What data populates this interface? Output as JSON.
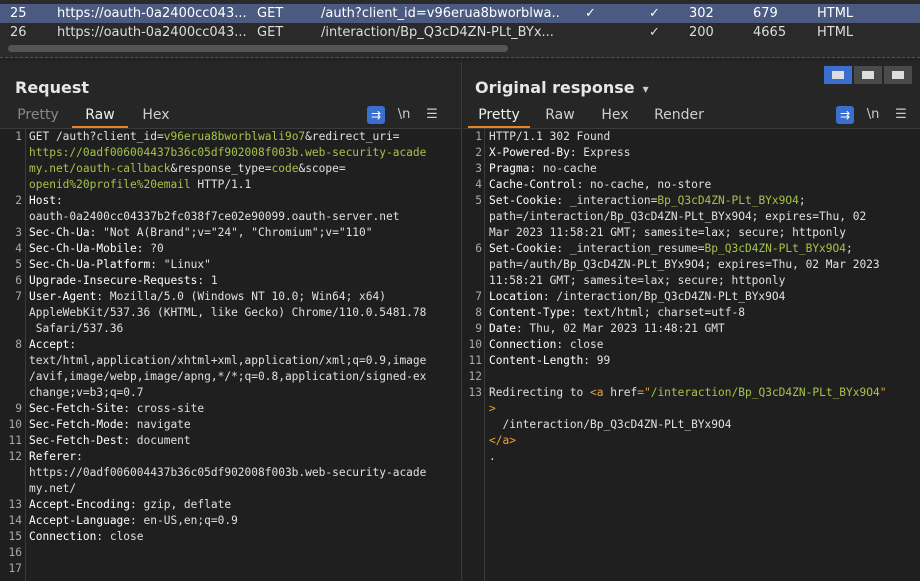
{
  "history": {
    "rows": [
      {
        "num": "25",
        "url": "https://oauth-0a2400cc043...",
        "method": "GET",
        "path": "/auth?client_id=v96erua8bworblwa...",
        "edited": "✓",
        "params": "✓",
        "status": "302",
        "length": "679",
        "mime": "HTML"
      },
      {
        "num": "26",
        "url": "https://oauth-0a2400cc043...",
        "method": "GET",
        "path": "/interaction/Bp_Q3cD4ZN-PLt_BYx...",
        "edited": "",
        "params": "✓",
        "status": "200",
        "length": "4665",
        "mime": "HTML"
      }
    ]
  },
  "request": {
    "title": "Request",
    "tabs": [
      "Pretty",
      "Raw",
      "Hex"
    ],
    "active_tab": "Raw",
    "tools": {
      "wrap": "⇉",
      "newline": "\\n",
      "menu": "☰"
    },
    "line_numbers": [
      "1",
      "",
      "",
      "",
      "2",
      "",
      "3",
      "4",
      "5",
      "6",
      "7",
      "",
      "",
      "8",
      "",
      "",
      "",
      "9",
      "10",
      "11",
      "12",
      "",
      "",
      "13",
      "14",
      "15",
      "16",
      "17"
    ],
    "lines": [
      [
        {
          "t": "GET /auth?client_id=",
          "c": "v"
        },
        {
          "t": "v96erua8bworblwali9o7",
          "c": "g"
        },
        {
          "t": "&redirect_uri=",
          "c": "v"
        }
      ],
      [
        {
          "t": "https://0adf006004437b36c05df902008f003b.web-security-acade",
          "c": "g"
        }
      ],
      [
        {
          "t": "my.net/oauth-callback",
          "c": "g"
        },
        {
          "t": "&response_type=",
          "c": "v"
        },
        {
          "t": "code",
          "c": "g"
        },
        {
          "t": "&scope=",
          "c": "v"
        }
      ],
      [
        {
          "t": "openid%20profile%20email",
          "c": "g"
        },
        {
          "t": " HTTP/1.1",
          "c": "v"
        }
      ],
      [
        {
          "t": "Host",
          "c": "k"
        },
        {
          "t": ":",
          "c": "v"
        }
      ],
      [
        {
          "t": "oauth-0a2400cc04337b2fc038f7ce02e90099.oauth-server.net",
          "c": "v"
        }
      ],
      [
        {
          "t": "Sec-Ch-Ua",
          "c": "k"
        },
        {
          "t": ": \"Not A(Brand\";v=\"24\", \"Chromium\";v=\"110\"",
          "c": "v"
        }
      ],
      [
        {
          "t": "Sec-Ch-Ua-Mobile",
          "c": "k"
        },
        {
          "t": ": ?0",
          "c": "v"
        }
      ],
      [
        {
          "t": "Sec-Ch-Ua-Platform",
          "c": "k"
        },
        {
          "t": ": \"Linux\"",
          "c": "v"
        }
      ],
      [
        {
          "t": "Upgrade-Insecure-Requests",
          "c": "k"
        },
        {
          "t": ": 1",
          "c": "v"
        }
      ],
      [
        {
          "t": "User-Agent",
          "c": "k"
        },
        {
          "t": ": Mozilla/5.0 (Windows NT 10.0; Win64; x64)",
          "c": "v"
        }
      ],
      [
        {
          "t": "AppleWebKit/537.36 (KHTML, like Gecko) Chrome/110.0.5481.78",
          "c": "v"
        }
      ],
      [
        {
          "t": " Safari/537.36",
          "c": "v"
        }
      ],
      [
        {
          "t": "Accept",
          "c": "k"
        },
        {
          "t": ":",
          "c": "v"
        }
      ],
      [
        {
          "t": "text/html,application/xhtml+xml,application/xml;q=0.9,image",
          "c": "v"
        }
      ],
      [
        {
          "t": "/avif,image/webp,image/apng,*/*;q=0.8,application/signed-ex",
          "c": "v"
        }
      ],
      [
        {
          "t": "change;v=b3;q=0.7",
          "c": "v"
        }
      ],
      [
        {
          "t": "Sec-Fetch-Site",
          "c": "k"
        },
        {
          "t": ": cross-site",
          "c": "v"
        }
      ],
      [
        {
          "t": "Sec-Fetch-Mode",
          "c": "k"
        },
        {
          "t": ": navigate",
          "c": "v"
        }
      ],
      [
        {
          "t": "Sec-Fetch-Dest",
          "c": "k"
        },
        {
          "t": ": document",
          "c": "v"
        }
      ],
      [
        {
          "t": "Referer",
          "c": "k"
        },
        {
          "t": ":",
          "c": "v"
        }
      ],
      [
        {
          "t": "https://0adf006004437b36c05df902008f003b.web-security-acade",
          "c": "v"
        }
      ],
      [
        {
          "t": "my.net/",
          "c": "v"
        }
      ],
      [
        {
          "t": "Accept-Encoding",
          "c": "k"
        },
        {
          "t": ": gzip, deflate",
          "c": "v"
        }
      ],
      [
        {
          "t": "Accept-Language",
          "c": "k"
        },
        {
          "t": ": en-US,en;q=0.9",
          "c": "v"
        }
      ],
      [
        {
          "t": "Connection",
          "c": "k"
        },
        {
          "t": ": close",
          "c": "v"
        }
      ],
      [
        {
          "t": "",
          "c": "v"
        }
      ],
      [
        {
          "t": "",
          "c": "v"
        }
      ]
    ]
  },
  "response": {
    "title": "Original response",
    "tabs": [
      "Pretty",
      "Raw",
      "Hex",
      "Render"
    ],
    "active_tab": "Pretty",
    "tools": {
      "wrap": "⇉",
      "newline": "\\n",
      "menu": "☰"
    },
    "line_numbers": [
      "1",
      "2",
      "3",
      "4",
      "5",
      "",
      "",
      "6",
      "",
      "",
      "7",
      "8",
      "9",
      "10",
      "11",
      "12",
      "13",
      "",
      "",
      "",
      ""
    ],
    "lines": [
      [
        {
          "t": "HTTP/1.1 302 Found",
          "c": "v"
        }
      ],
      [
        {
          "t": "X-Powered-By",
          "c": "k"
        },
        {
          "t": ": Express",
          "c": "v"
        }
      ],
      [
        {
          "t": "Pragma",
          "c": "k"
        },
        {
          "t": ": no-cache",
          "c": "v"
        }
      ],
      [
        {
          "t": "Cache-Control",
          "c": "k"
        },
        {
          "t": ": no-cache, no-store",
          "c": "v"
        }
      ],
      [
        {
          "t": "Set-Cookie",
          "c": "k"
        },
        {
          "t": ": _interaction=",
          "c": "v"
        },
        {
          "t": "Bp_Q3cD4ZN-PLt_BYx9O4",
          "c": "g"
        },
        {
          "t": ";",
          "c": "v"
        }
      ],
      [
        {
          "t": "path=/interaction/Bp_Q3cD4ZN-PLt_BYx9O4; expires=Thu, 02",
          "c": "v"
        }
      ],
      [
        {
          "t": "Mar 2023 11:58:21 GMT; samesite=lax; secure; httponly",
          "c": "v"
        }
      ],
      [
        {
          "t": "Set-Cookie",
          "c": "k"
        },
        {
          "t": ": _interaction_resume=",
          "c": "v"
        },
        {
          "t": "Bp_Q3cD4ZN-PLt_BYx9O4",
          "c": "g"
        },
        {
          "t": ";",
          "c": "v"
        }
      ],
      [
        {
          "t": "path=/auth/Bp_Q3cD4ZN-PLt_BYx9O4; expires=Thu, 02 Mar 2023",
          "c": "v"
        }
      ],
      [
        {
          "t": "11:58:21 GMT; samesite=lax; secure; httponly",
          "c": "v"
        }
      ],
      [
        {
          "t": "Location",
          "c": "k"
        },
        {
          "t": ": /interaction/Bp_Q3cD4ZN-PLt_BYx9O4",
          "c": "v"
        }
      ],
      [
        {
          "t": "Content-Type",
          "c": "k"
        },
        {
          "t": ": text/html; charset=utf-8",
          "c": "v"
        }
      ],
      [
        {
          "t": "Date",
          "c": "k"
        },
        {
          "t": ": Thu, 02 Mar 2023 11:48:21 GMT",
          "c": "v"
        }
      ],
      [
        {
          "t": "Connection",
          "c": "k"
        },
        {
          "t": ": close",
          "c": "v"
        }
      ],
      [
        {
          "t": "Content-Length",
          "c": "k"
        },
        {
          "t": ": 99",
          "c": "v"
        }
      ],
      [
        {
          "t": "",
          "c": "v"
        }
      ],
      [
        {
          "t": "Redirecting to ",
          "c": "v"
        },
        {
          "t": "<a ",
          "c": "o"
        },
        {
          "t": "href",
          "c": "v"
        },
        {
          "t": "=\"",
          "c": "o"
        },
        {
          "t": "/interaction/Bp_Q3cD4ZN-PLt_BYx9O4",
          "c": "g"
        },
        {
          "t": "\"",
          "c": "o"
        }
      ],
      [
        {
          "t": ">",
          "c": "o"
        }
      ],
      [
        {
          "t": "  /interaction/Bp_Q3cD4ZN-PLt_BYx9O4",
          "c": "v"
        }
      ],
      [
        {
          "t": "</a>",
          "c": "o"
        }
      ],
      [
        {
          "t": ".",
          "c": "v"
        }
      ]
    ]
  },
  "colors": {
    "accent_tab": "#e8832a",
    "selected_row": "#4a5a80",
    "value_green": "#a6c34a",
    "tag_orange": "#e8a33a",
    "tool_blue": "#3a6fcf"
  }
}
